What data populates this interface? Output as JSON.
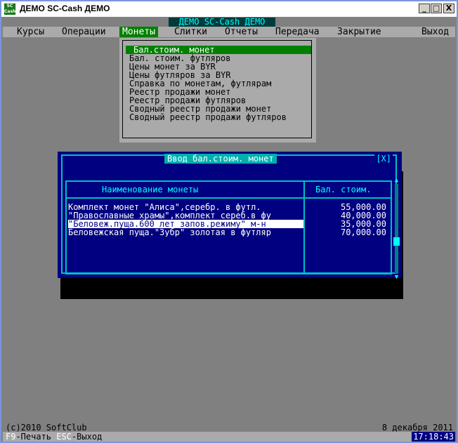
{
  "window": {
    "title": "ДЕМО SC-Cash ДЕМО",
    "icon_text": "SC\nCash",
    "minimize": "_",
    "maximize": "□",
    "close": "X"
  },
  "app_title": "ДЕМО SC-Cash ДЕМО",
  "menu": [
    {
      "label": "Курсы"
    },
    {
      "label": "Операции"
    },
    {
      "label": "Монеты"
    },
    {
      "label": "Слитки"
    },
    {
      "label": "Отчеты"
    },
    {
      "label": "Передача"
    },
    {
      "label": "Закрытие"
    },
    {
      "label": "Выход"
    }
  ],
  "dropdown": {
    "items": [
      "Бал.стоим. монет",
      "Бал. стоим. футляров",
      "Цены монет за BYR",
      "Цены футляров за BYR",
      "Справка по монетам, футлярам",
      "Реестр продажи монет",
      "Реестр продажи футляров",
      "Сводный реестр продажи монет",
      "Сводный реестр продажи футляров"
    ]
  },
  "dialog": {
    "title": "Ввод бал.стоим. монет",
    "close": "[X]",
    "col_name": "Наименование монеты",
    "col_value": "Бал. стоим.",
    "rows": [
      {
        "name": "Комплект монет \"Алиса\",серебр. в футл.",
        "value": "55,000.00"
      },
      {
        "name": "\"Православные храмы\",комплект сереб.в фу",
        "value": "40,000.00"
      },
      {
        "name": "\"Беловеж.пуща.600 лет запов.режиму\" м-н",
        "value": "35,000.00"
      },
      {
        "name": "Беловежская пуща.\"Зубр\" золотая в футляр",
        "value": "70,000.00"
      }
    ]
  },
  "footer": {
    "copyright": "(c)2010 SoftClub",
    "date": "8 декабря 2011",
    "hk1_key": "F9",
    "hk1_label": "-Печать",
    "hk2_key": "ESC",
    "hk2_label": "-Выход",
    "clock": "17:18:43"
  },
  "colors": {
    "menu_active": "#008000",
    "dialog_bg": "#000080",
    "frame": "#00c0c0"
  }
}
